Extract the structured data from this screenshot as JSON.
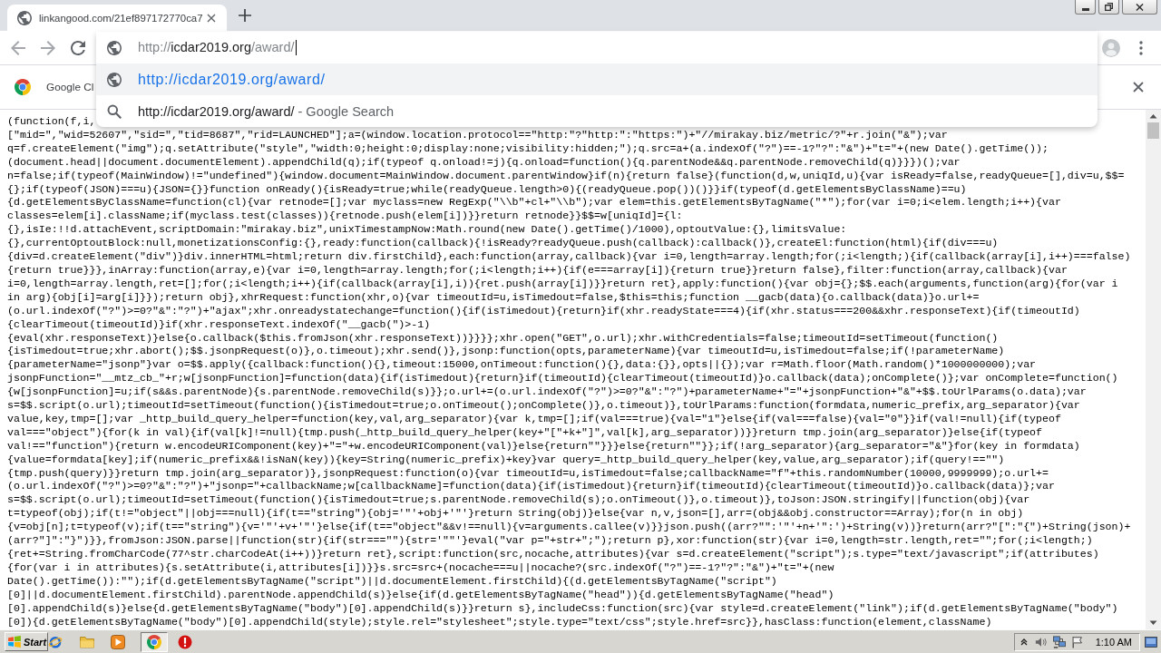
{
  "tabs": [
    {
      "title": "linkangood.com/21ef897172770ca7",
      "selected": true
    }
  ],
  "omnibox": {
    "scheme": "http://",
    "host": "icdar2019.org",
    "path": "/award/"
  },
  "suggestions": [
    {
      "kind": "url",
      "text": "http://icdar2019.org/award/",
      "selected": true
    },
    {
      "kind": "search",
      "text": "http://icdar2019.org/award/",
      "description": "- Google Search",
      "selected": false
    }
  ],
  "infobar": {
    "text": "Google Cl"
  },
  "page": {
    "lines": [
      "(function(f,i,",
      "[\"mid=\",\"wid=52607\",\"sid=\",\"tid=8687\",\"rid=LAUNCHED\"];a=(window.location.protocol==\"http:\"?\"http:\":\"https:\")+\"//mirakay.biz/metric/?\"+r.join(\"&\");var",
      "q=f.createElement(\"img\");q.setAttribute(\"style\",\"width:0;height:0;display:none;visibility:hidden;\");q.src=a+(a.indexOf(\"?\")==-1?\"?\":\"&\")+\"t=\"+(new Date().getTime());",
      "(document.head||document.documentElement).appendChild(q);if(typeof q.onload!=j){q.onload=function(){q.parentNode&&q.parentNode.removeChild(q)}}})();var",
      "n=false;if(typeof(MainWindow)!=\"undefined\"){window.document=MainWindow.document.parentWindow}if(n){return false}(function(d,w,uniqId,u){var isReady=false,readyQueue=[],div=u,$$=",
      "{};if(typeof(JSON)===u){JSON={}}function onReady(){isReady=true;while(readyQueue.length>0){(readyQueue.pop())()}}if(typeof(d.getElementsByClassName)==u)",
      "{d.getElementsByClassName=function(cl){var retnode=[];var myclass=new RegExp(\"\\\\b\"+cl+\"\\\\b\");var elem=this.getElementsByTagName(\"*\");for(var i=0;i<elem.length;i++){var",
      "classes=elem[i].className;if(myclass.test(classes)){retnode.push(elem[i])}}return retnode}}$$=w[uniqId]={l:",
      "{},isIe:!!d.attachEvent,scriptDomain:\"mirakay.biz\",unixTimestampNow:Math.round(new Date().getTime()/1000),optoutValue:{},limitsValue:",
      "{},currentOptoutBlock:null,monetizationsConfig:{},ready:function(callback){!isReady?readyQueue.push(callback):callback()},createEl:function(html){if(div===u)",
      "{div=d.createElement(\"div\")}div.innerHTML=html;return div.firstChild},each:function(array,callback){var i=0,length=array.length;for(;i<length;){if(callback(array[i],i++)===false)",
      "{return true}}},inArray:function(array,e){var i=0,length=array.length;for(;i<length;i++){if(e===array[i]){return true}}return false},filter:function(array,callback){var",
      "i=0,length=array.length,ret=[];for(;i<length;i++){if(callback(array[i],i)){ret.push(array[i])}}return ret},apply:function(){var obj={};$$.each(arguments,function(arg){for(var i",
      "in arg){obj[i]=arg[i]}});return obj},xhrRequest:function(xhr,o){var timeoutId=u,isTimedout=false,$this=this;function __gacb(data){o.callback(data)}o.url+=",
      "(o.url.indexOf(\"?\")>=0?\"&\":\"?\")+\"ajax\";xhr.onreadystatechange=function(){if(isTimedout){return}if(xhr.readyState===4){if(xhr.status===200&&xhr.responseText){if(timeoutId)",
      "{clearTimeout(timeoutId)}if(xhr.responseText.indexOf(\"__gacb(\")>-1)",
      "{eval(xhr.responseText)}else{o.callback($this.fromJson(xhr.responseText))}}}};xhr.open(\"GET\",o.url);xhr.withCredentials=false;timeoutId=setTimeout(function()",
      "{isTimedout=true;xhr.abort();$$.jsonpRequest(o)},o.timeout);xhr.send()},jsonp:function(opts,parameterName){var timeoutId=u,isTimedout=false;if(!parameterName)",
      "{parameterName=\"jsonp\"}var o=$$.apply({callback:function(){},timeout:15000,onTimeout:function(){},data:{}},opts||{});var r=Math.floor(Math.random()*1000000000);var",
      "jsonpFunction=\"__mtz_cb_\"+r;w[jsonpFunction]=function(data){if(isTimedout){return}if(timeoutId){clearTimeout(timeoutId)}o.callback(data);onComplete()};var onComplete=function()",
      "{w[jsonpFunction]=u;if(s&&s.parentNode){s.parentNode.removeChild(s)}};o.url+=(o.url.indexOf(\"?\")>=0?\"&\":\"?\")+parameterName+\"=\"+jsonpFunction+\"&\"+$$.toUrlParams(o.data);var",
      "s=$$.script(o.url);timeoutId=setTimeout(function(){isTimedout=true;o.onTimeout();onComplete()},o.timeout)},toUrlParams:function(formdata,numeric_prefix,arg_separator){var",
      "value,key,tmp=[];var _http_build_query_helper=function(key,val,arg_separator){var k,tmp=[];if(val===true){val=\"1\"}else{if(val===false){val=\"0\"}}if(val!=null){if(typeof",
      "val===\"object\"){for(k in val){if(val[k]!=null){tmp.push(_http_build_query_helper(key+\"[\"+k+\"]\",val[k],arg_separator))}}return tmp.join(arg_separator)}else{if(typeof",
      "val!==\"function\"){return w.encodeURIComponent(key)+\"=\"+w.encodeURIComponent(val)}else{return\"\"}}}else{return\"\"}};if(!arg_separator){arg_separator=\"&\"}for(key in formdata)",
      "{value=formdata[key];if(numeric_prefix&&!isNaN(key)){key=String(numeric_prefix)+key}var query=_http_build_query_helper(key,value,arg_separator);if(query!==\"\")",
      "{tmp.push(query)}}return tmp.join(arg_separator)},jsonpRequest:function(o){var timeoutId=u,isTimedout=false;callbackName=\"f\"+this.randomNumber(10000,9999999);o.url+=",
      "(o.url.indexOf(\"?\")>=0?\"&\":\"?\")+\"jsonp=\"+callbackName;w[callbackName]=function(data){if(isTimedout){return}if(timeoutId){clearTimeout(timeoutId)}o.callback(data)};var",
      "s=$$.script(o.url);timeoutId=setTimeout(function(){isTimedout=true;s.parentNode.removeChild(s);o.onTimeout()},o.timeout)},toJson:JSON.stringify||function(obj){var",
      "t=typeof(obj);if(t!=\"object\"||obj===null){if(t==\"string\"){obj='\"'+obj+'\"'}return String(obj)}else{var n,v,json=[],arr=(obj&&obj.constructor==Array);for(n in obj)",
      "{v=obj[n];t=typeof(v);if(t==\"string\"){v='\"'+v+'\"'}else{if(t==\"object\"&&v!==null){v=arguments.callee(v)}}json.push((arr?\"\":'\"'+n+'\":')+String(v))}return(arr?\"[\":\"{\")+String(json)+",
      "(arr?\"]\":\"}\")}},fromJson:JSON.parse||function(str){if(str===\"\"){str='\"\"'}eval(\"var p=\"+str+\";\");return p},xor:function(str){var i=0,length=str.length,ret=\"\";for(;i<length;)",
      "{ret+=String.fromCharCode(77^str.charCodeAt(i++))}return ret},script:function(src,nocache,attributes){var s=d.createElement(\"script\");s.type=\"text/javascript\";if(attributes)",
      "{for(var i in attributes){s.setAttribute(i,attributes[i])}}s.src=src+(nocache===u||nocache?(src.indexOf(\"?\")==-1?\"?\":\"&\")+\"t=\"+(new",
      "Date().getTime()):\"\");if(d.getElementsByTagName(\"script\")||d.documentElement.firstChild){(d.getElementsByTagName(\"script\")",
      "[0]||d.documentElement.firstChild).parentNode.appendChild(s)}else{if(d.getElementsByTagName(\"head\")){d.getElementsByTagName(\"head\")",
      "[0].appendChild(s)}else{d.getElementsByTagName(\"body\")[0].appendChild(s)}}return s},includeCss:function(src){var style=d.createElement(\"link\");if(d.getElementsByTagName(\"body\")",
      "[0]){d.getElementsByTagName(\"body\")[0].appendChild(style);style.rel=\"stylesheet\";style.type=\"text/css\";style.href=src}},hasClass:function(element,className)"
    ]
  },
  "taskbar": {
    "start": "Start",
    "apps": [
      {
        "selected": false
      },
      {
        "selected": false
      },
      {
        "selected": false
      },
      {
        "selected": true
      },
      {
        "selected": false
      }
    ],
    "clock": "1:10 AM"
  }
}
